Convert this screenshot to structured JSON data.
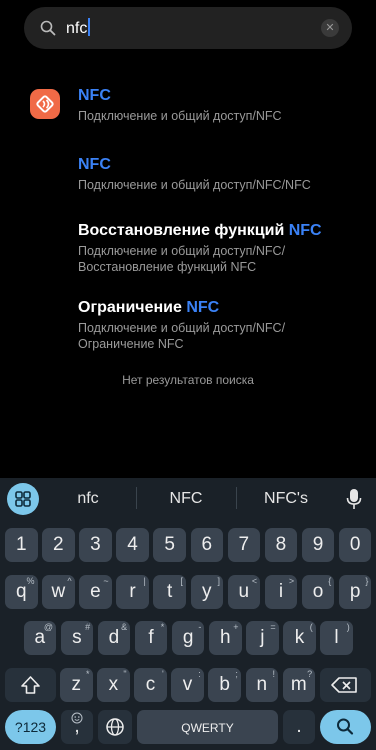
{
  "search": {
    "query": "nfc",
    "search_icon": "search-icon",
    "clear_icon": "close-icon"
  },
  "results": [
    {
      "title_prefix": "",
      "title_highlight": "NFC",
      "subtitle_lines": [
        "Подключение и общий доступ/NFC"
      ],
      "has_icon": true
    },
    {
      "title_prefix": "",
      "title_highlight": "NFC",
      "subtitle_lines": [
        "Подключение и общий доступ/NFC/NFC"
      ],
      "has_icon": false
    },
    {
      "title_prefix": "Восстановление функций ",
      "title_highlight": "NFC",
      "subtitle_lines": [
        "Подключение и общий доступ/NFC/",
        "Восстановление функций NFC"
      ],
      "has_icon": false
    },
    {
      "title_prefix": "Ограничение ",
      "title_highlight": "NFC",
      "subtitle_lines": [
        "Подключение и общий доступ/NFC/",
        "Ограничение NFC"
      ],
      "has_icon": false
    }
  ],
  "no_results": "Нет результатов поиска",
  "keyboard": {
    "suggestions": [
      "nfc",
      "NFC",
      "NFC's"
    ],
    "numbers": [
      "1",
      "2",
      "3",
      "4",
      "5",
      "6",
      "7",
      "8",
      "9",
      "0"
    ],
    "row1": [
      {
        "k": "q",
        "a": "%"
      },
      {
        "k": "w",
        "a": "^"
      },
      {
        "k": "e",
        "a": "~"
      },
      {
        "k": "r",
        "a": "|"
      },
      {
        "k": "t",
        "a": "["
      },
      {
        "k": "y",
        "a": "]"
      },
      {
        "k": "u",
        "a": "<"
      },
      {
        "k": "i",
        "a": ">"
      },
      {
        "k": "o",
        "a": "{"
      },
      {
        "k": "p",
        "a": "}"
      }
    ],
    "row2": [
      {
        "k": "a",
        "a": "@"
      },
      {
        "k": "s",
        "a": "#"
      },
      {
        "k": "d",
        "a": "&"
      },
      {
        "k": "f",
        "a": "*"
      },
      {
        "k": "g",
        "a": "-"
      },
      {
        "k": "h",
        "a": "+"
      },
      {
        "k": "j",
        "a": "="
      },
      {
        "k": "k",
        "a": "("
      },
      {
        "k": "l",
        "a": ")"
      }
    ],
    "row3": [
      {
        "k": "z",
        "a": "*"
      },
      {
        "k": "x",
        "a": "\""
      },
      {
        "k": "c",
        "a": "'"
      },
      {
        "k": "v",
        "a": ":"
      },
      {
        "k": "b",
        "a": ";"
      },
      {
        "k": "n",
        "a": "!"
      },
      {
        "k": "m",
        "a": "?"
      }
    ],
    "symbols_label": "?123",
    "comma_label": ",",
    "space_label": "QWERTY",
    "period_label": "."
  },
  "colors": {
    "accent": "#3b82f6",
    "app_icon": "#f06a46",
    "keyboard_bg": "#1a2128",
    "key_bg": "#3a4450",
    "key_action": "#7cc7ea"
  }
}
